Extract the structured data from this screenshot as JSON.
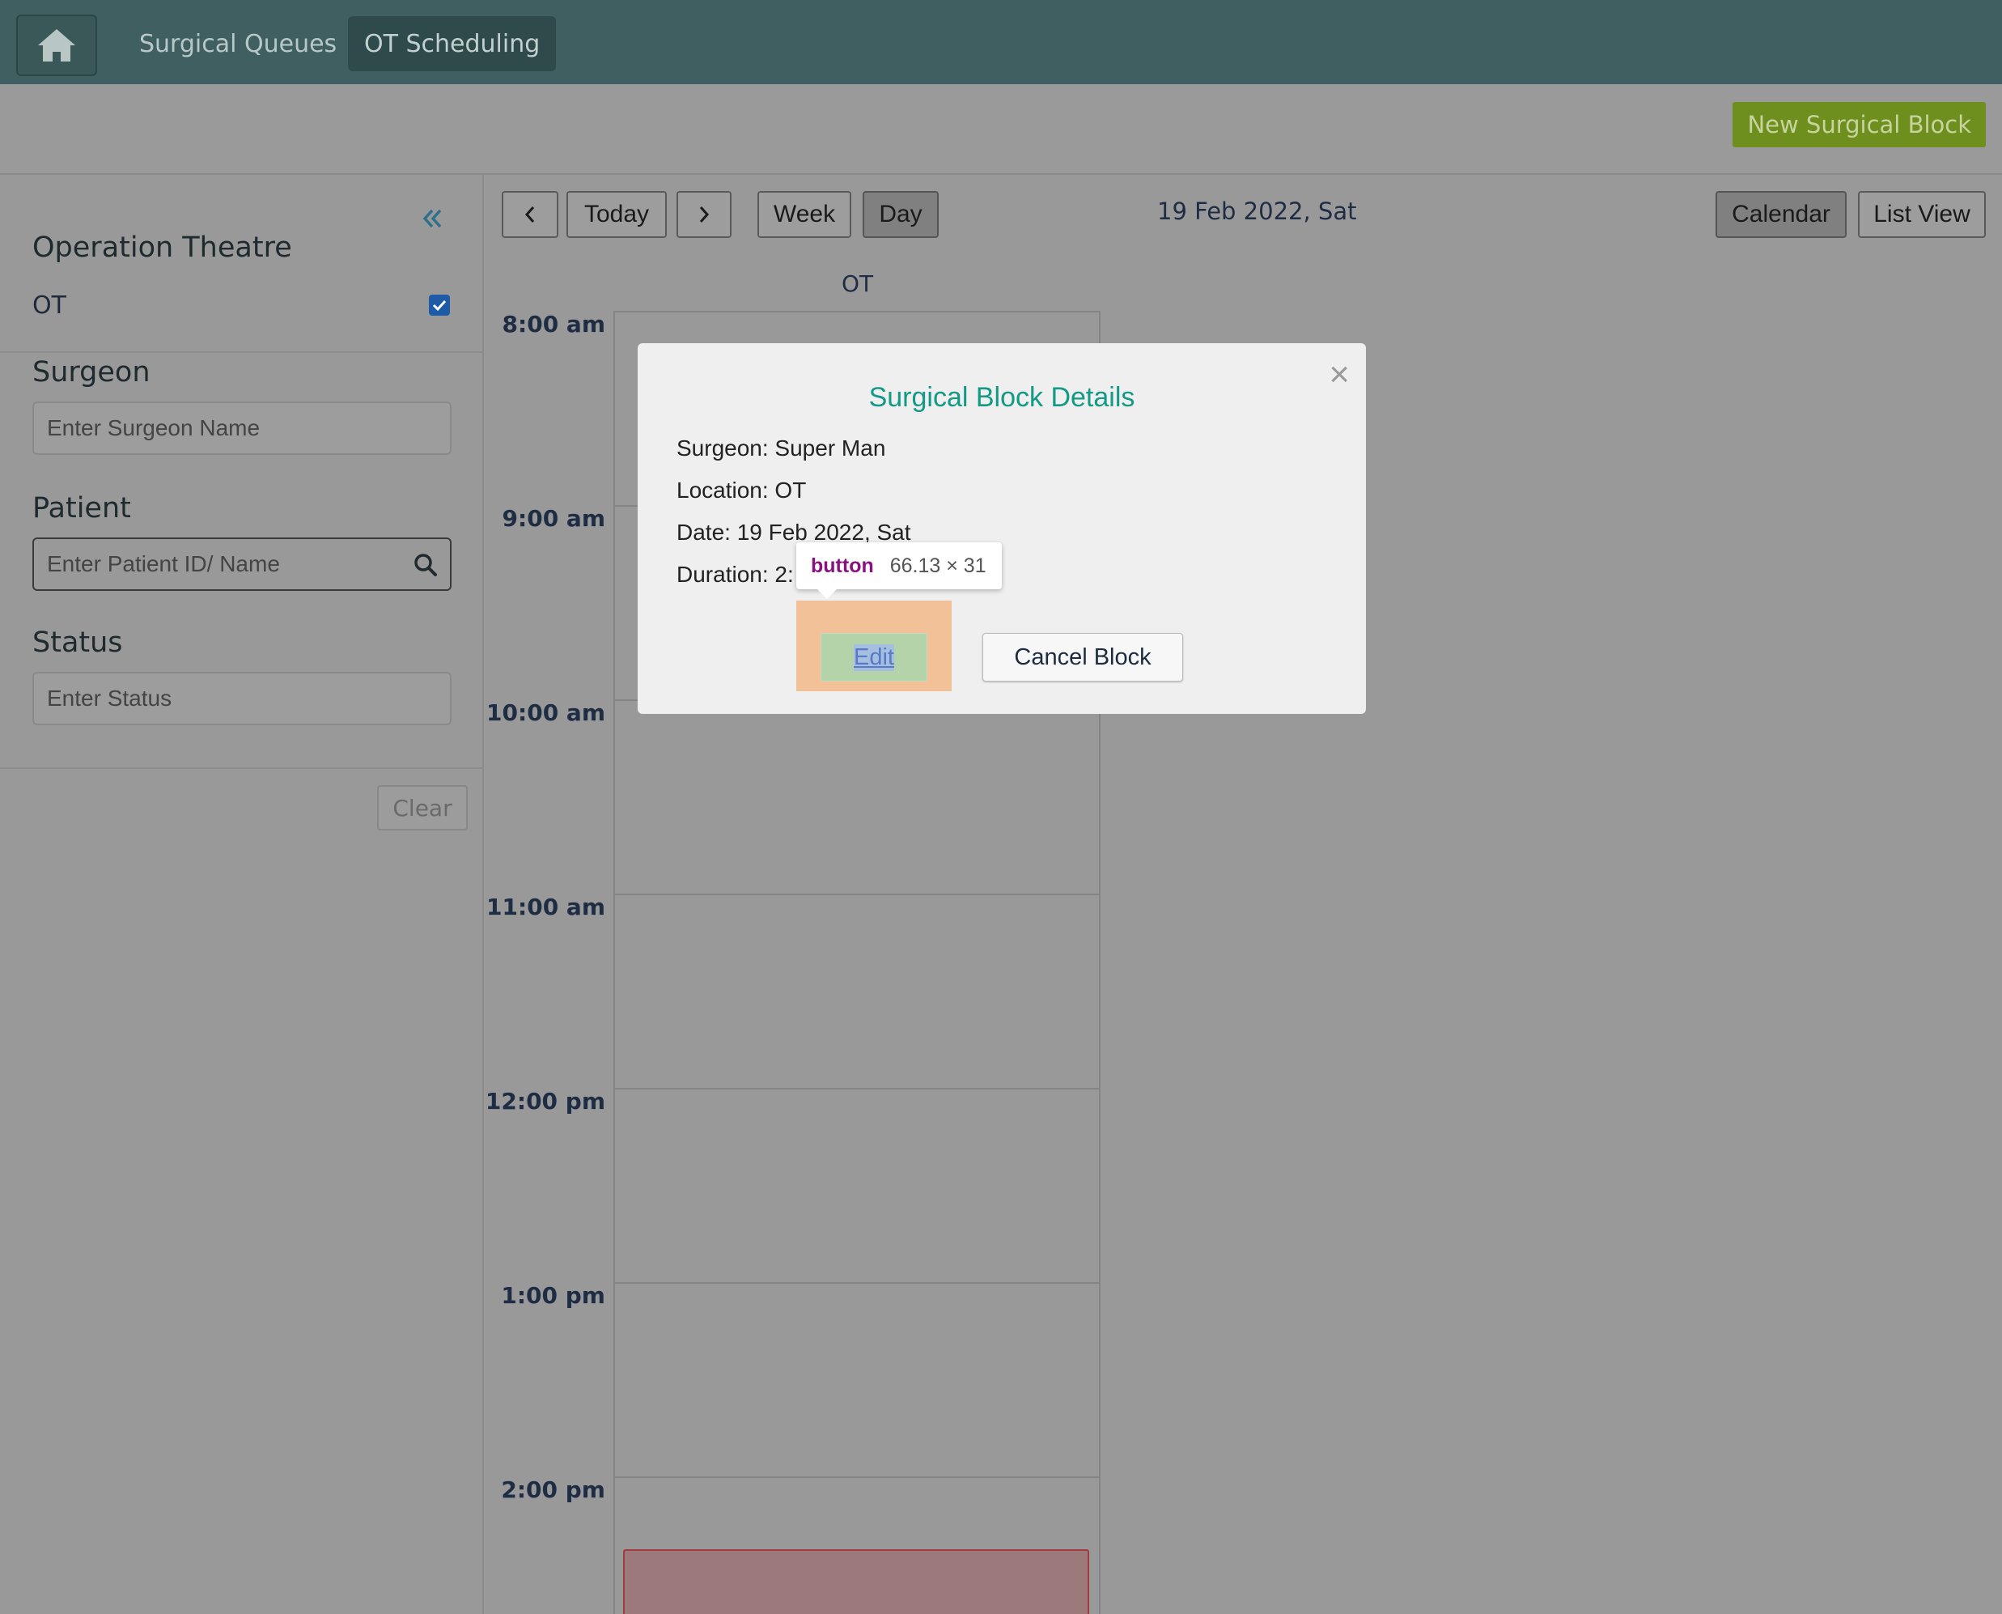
{
  "nav": {
    "links": [
      "Surgical Queues",
      "OT Scheduling"
    ],
    "active_index": 1
  },
  "header": {
    "new_block_label": "New Surgical Block"
  },
  "sidebar": {
    "ot_section_title": "Operation Theatre",
    "ot_item_label": "OT",
    "ot_checked": true,
    "surgeon_title": "Surgeon",
    "surgeon_placeholder": "Enter Surgeon Name",
    "patient_title": "Patient",
    "patient_placeholder": "Enter Patient ID/ Name",
    "status_title": "Status",
    "status_placeholder": "Enter Status",
    "clear_label": "Clear"
  },
  "toolbar": {
    "prev_label": "‹",
    "today_label": "Today",
    "next_label": "›",
    "week_label": "Week",
    "day_label": "Day",
    "date_title": "19 Feb 2022, Sat",
    "calendar_label": "Calendar",
    "list_view_label": "List View"
  },
  "calendar": {
    "column_header": "OT",
    "times": [
      "8:00 am",
      "9:00 am",
      "10:00 am",
      "11:00 am",
      "12:00 pm",
      "1:00 pm",
      "2:00 pm"
    ]
  },
  "modal": {
    "title": "Surgical Block Details",
    "surgeon_line": "Surgeon: Super Man",
    "location_line": "Location: OT",
    "date_line": "Date: 19 Feb 2022, Sat",
    "duration_line": "Duration: 2:",
    "close_glyph": "×",
    "edit_label": "Edit",
    "cancel_label": "Cancel Block"
  },
  "tooltip": {
    "tag": "button",
    "dimensions": "66.13 × 31"
  },
  "colors": {
    "nav_bg": "#3f5f60",
    "accent_green": "#6e8f1e",
    "modal_title": "#129a86",
    "event_border": "#a23c3c"
  }
}
